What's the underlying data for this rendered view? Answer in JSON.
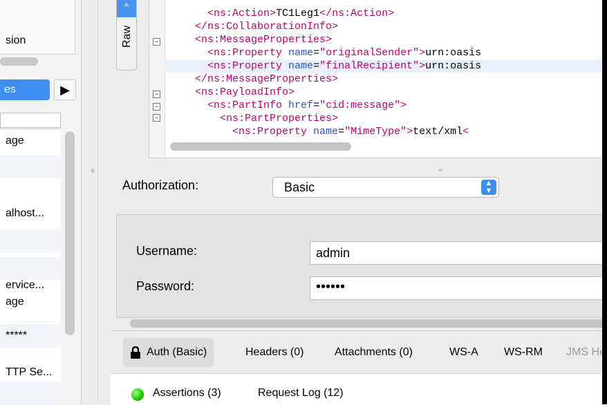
{
  "navigator": {
    "top_text": "sion",
    "tab_label": "es",
    "items": [
      {
        "label": "age"
      },
      {
        "label": ""
      },
      {
        "label": "alhost..."
      },
      {
        "label": ""
      },
      {
        "label": ""
      },
      {
        "label": "ervice..."
      },
      {
        "label": "age"
      },
      {
        "label": "*****"
      },
      {
        "label": "TTP Se..."
      },
      {
        "label": ""
      }
    ]
  },
  "editor": {
    "raw_tab_label": "Raw",
    "lines": [
      {
        "indent": "      ",
        "parts": [
          [
            "tag",
            "<ns:Action>"
          ],
          [
            "txt",
            "TC1Leg1"
          ],
          [
            "tag",
            "</ns:Action>"
          ]
        ]
      },
      {
        "indent": "    ",
        "parts": [
          [
            "tag",
            "</ns:CollaborationInfo>"
          ]
        ]
      },
      {
        "indent": "    ",
        "parts": [
          [
            "tag",
            "<ns:MessageProperties>"
          ]
        ]
      },
      {
        "indent": "      ",
        "parts": [
          [
            "tag",
            "<ns:Property "
          ],
          [
            "at",
            "name"
          ],
          [
            "txt",
            "="
          ],
          [
            "val",
            "\"originalSender\""
          ],
          [
            "tag",
            ">"
          ],
          [
            "txt",
            "urn:oasis"
          ]
        ]
      },
      {
        "indent": "      ",
        "parts": [
          [
            "tag",
            "<ns:Property "
          ],
          [
            "at",
            "name"
          ],
          [
            "txt",
            "="
          ],
          [
            "val",
            "\"finalRecipient\""
          ],
          [
            "tag",
            ">"
          ],
          [
            "txt",
            "urn:oasis"
          ]
        ]
      },
      {
        "indent": "    ",
        "parts": [
          [
            "tag",
            "</ns:MessageProperties>"
          ]
        ]
      },
      {
        "indent": "    ",
        "parts": [
          [
            "tag",
            "<ns:PayloadInfo>"
          ]
        ]
      },
      {
        "indent": "      ",
        "parts": [
          [
            "tag",
            "<ns:PartInfo "
          ],
          [
            "at",
            "href"
          ],
          [
            "txt",
            "="
          ],
          [
            "val",
            "\"cid:message\""
          ],
          [
            "tag",
            ">"
          ]
        ]
      },
      {
        "indent": "        ",
        "parts": [
          [
            "tag",
            "<ns:PartProperties>"
          ]
        ]
      },
      {
        "indent": "          ",
        "parts": [
          [
            "tag",
            "<ns:Property "
          ],
          [
            "at",
            "name"
          ],
          [
            "txt",
            "="
          ],
          [
            "val",
            "\"MimeType\""
          ],
          [
            "tag",
            ">"
          ],
          [
            "txt",
            "text/xml"
          ],
          [
            "tag",
            "<"
          ]
        ]
      }
    ]
  },
  "auth": {
    "authorization_label": "Authorization:",
    "authorization_value": "Basic",
    "username_label": "Username:",
    "username_value": "admin",
    "password_label": "Password:",
    "password_value": "••••••"
  },
  "tabs": [
    {
      "label": "Auth (Basic)",
      "selected": true
    },
    {
      "label": "Headers (0)"
    },
    {
      "label": "Attachments (0)"
    },
    {
      "label": "WS-A"
    },
    {
      "label": "WS-RM"
    },
    {
      "label": "JMS Hea",
      "disabled": true
    }
  ],
  "bottom": {
    "assertions_label": "Assertions (3)",
    "request_log_label": "Request Log (12)",
    "status_color": "#18c400"
  }
}
